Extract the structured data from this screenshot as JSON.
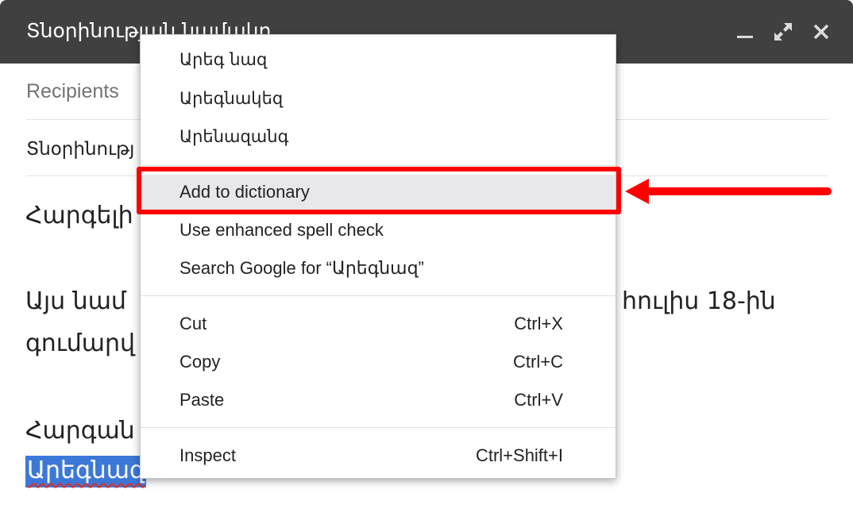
{
  "compose": {
    "title": "Տնօրինության նամակը",
    "recipients_placeholder": "Recipients",
    "subject": "Տնօրինությ"
  },
  "body": {
    "line1": "Հարգելի",
    "line2_start": "Այս նամ",
    "line2_end": "հուլիս 18-ին",
    "line3": "գումարվ",
    "line4": "Հարգան",
    "selected_word": "Արեգնազ"
  },
  "context_menu": {
    "suggestions": [
      "Արեգ նազ",
      "Արեգնակեզ",
      "Արենազանգ"
    ],
    "add_to_dictionary": "Add to dictionary",
    "enhanced_spell_check": "Use enhanced spell check",
    "search_google": "Search Google for “Արեգնազ”",
    "cut": {
      "label": "Cut",
      "shortcut": "Ctrl+X"
    },
    "copy": {
      "label": "Copy",
      "shortcut": "Ctrl+C"
    },
    "paste": {
      "label": "Paste",
      "shortcut": "Ctrl+V"
    },
    "inspect": {
      "label": "Inspect",
      "shortcut": "Ctrl+Shift+I"
    }
  },
  "icons": {
    "minimize": "minimize-icon",
    "fullscreen": "fullscreen-icon",
    "close": "close-icon"
  },
  "colors": {
    "header_bg": "#404040",
    "annotation": "#ff0000",
    "selection": "#3c78d8",
    "menu_highlight": "#e8e8ec"
  }
}
